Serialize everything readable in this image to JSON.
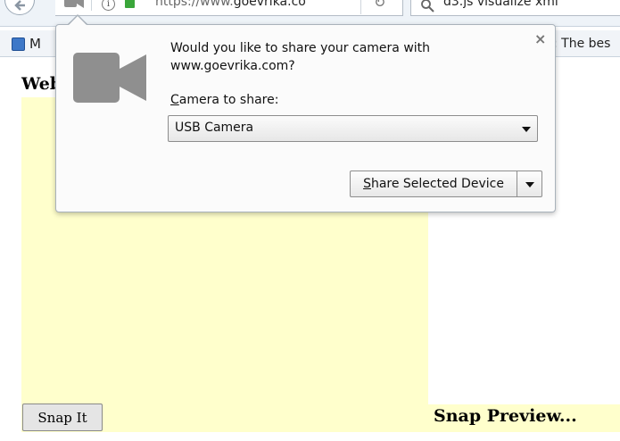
{
  "browser": {
    "url_prefix": "https://www.",
    "url_domain": "goevrika.co",
    "search_text": "d3.js visualize xml",
    "bookmark_label": "M",
    "bookmark_right_text": ": The bes"
  },
  "page": {
    "heading": "Web",
    "snap_button_label": "Snap It",
    "preview_title": "Snap Preview..."
  },
  "permission_prompt": {
    "message": "Would you like to share your camera with www.goevrika.com?",
    "camera_label_accesskey": "C",
    "camera_label_rest": "amera to share:",
    "selected_camera": "USB Camera",
    "share_button_accesskey": "S",
    "share_button_rest": "hare Selected Device",
    "close_glyph": "×"
  },
  "icons": [
    "back-arrow-icon",
    "camera-icon",
    "info-icon",
    "lock-icon",
    "reload-icon",
    "search-icon",
    "bookmark-icon",
    "close-icon",
    "chevron-down-icon"
  ],
  "colors": {
    "page_yellow": "#ffffcc",
    "lock_green": "#3aa63a",
    "camera_gray": "#8f8f8f"
  }
}
